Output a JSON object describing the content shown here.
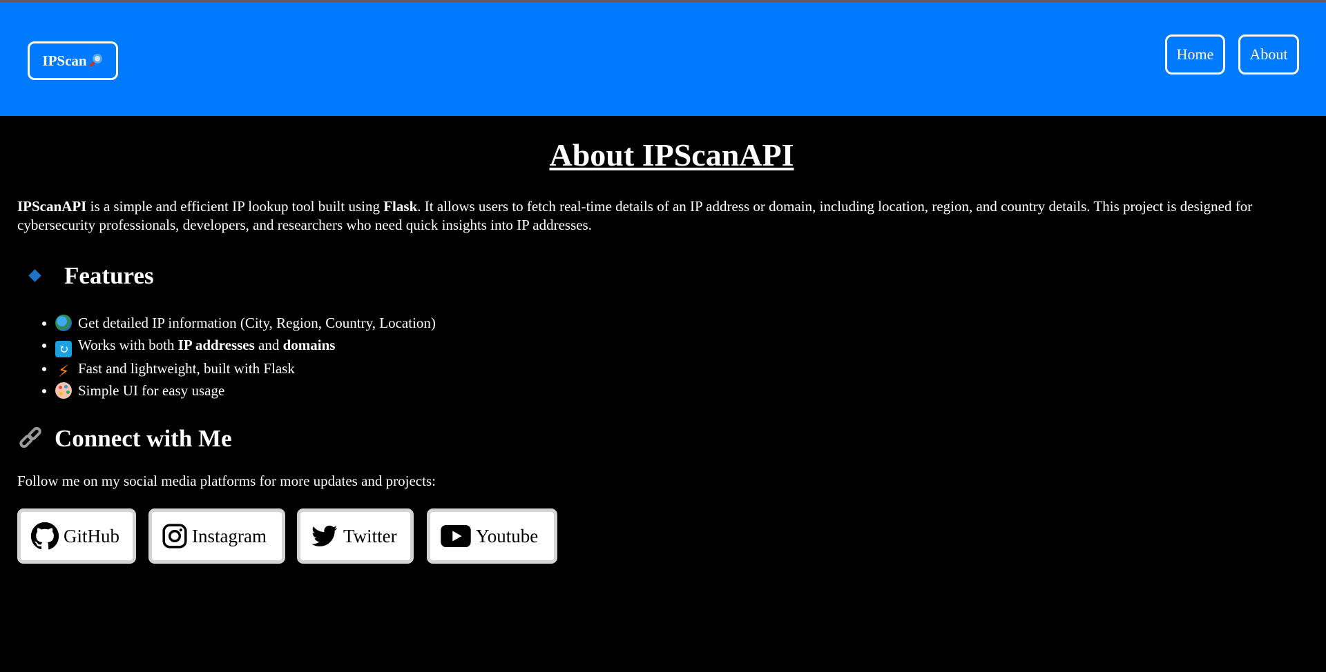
{
  "navbar": {
    "logo_text": "IPScan",
    "logo_icon": "magnifying-glass-icon",
    "links": [
      {
        "label": "Home"
      },
      {
        "label": "About"
      }
    ],
    "color": "#007bff"
  },
  "main": {
    "title": "About IPScanAPI",
    "intro": {
      "b1": "IPScanAPI",
      "t1": " is a simple and efficient IP lookup tool built using ",
      "b2": "Flask",
      "t2": ". It allows users to fetch real-time details of an IP address or domain, including location, region, and country details. This project is designed for cybersecurity professionals, developers, and researchers who need quick insights into IP addresses."
    },
    "features": {
      "heading": "Features",
      "heading_icon": "blue-diamond-icon",
      "items": [
        {
          "icon": "globe-icon",
          "text": "Get detailed IP information (City, Region, Country, Location)"
        },
        {
          "icon": "arrows-icon",
          "text_pre": "Works with both ",
          "bold1": "IP addresses",
          "text_mid": " and ",
          "bold2": "domains"
        },
        {
          "icon": "lightning-icon",
          "text": "Fast and lightweight, built with Flask"
        },
        {
          "icon": "palette-icon",
          "text": "Simple UI for easy usage"
        }
      ]
    },
    "connect": {
      "heading": "Connect with Me",
      "heading_icon": "link-icon",
      "follow_text": "Follow me on my social media platforms for more updates and projects:",
      "socials": [
        {
          "label": "GitHub",
          "icon": "github-icon"
        },
        {
          "label": "Instagram",
          "icon": "instagram-icon"
        },
        {
          "label": "Twitter",
          "icon": "twitter-icon"
        },
        {
          "label": "Youtube",
          "icon": "youtube-icon"
        }
      ]
    }
  }
}
